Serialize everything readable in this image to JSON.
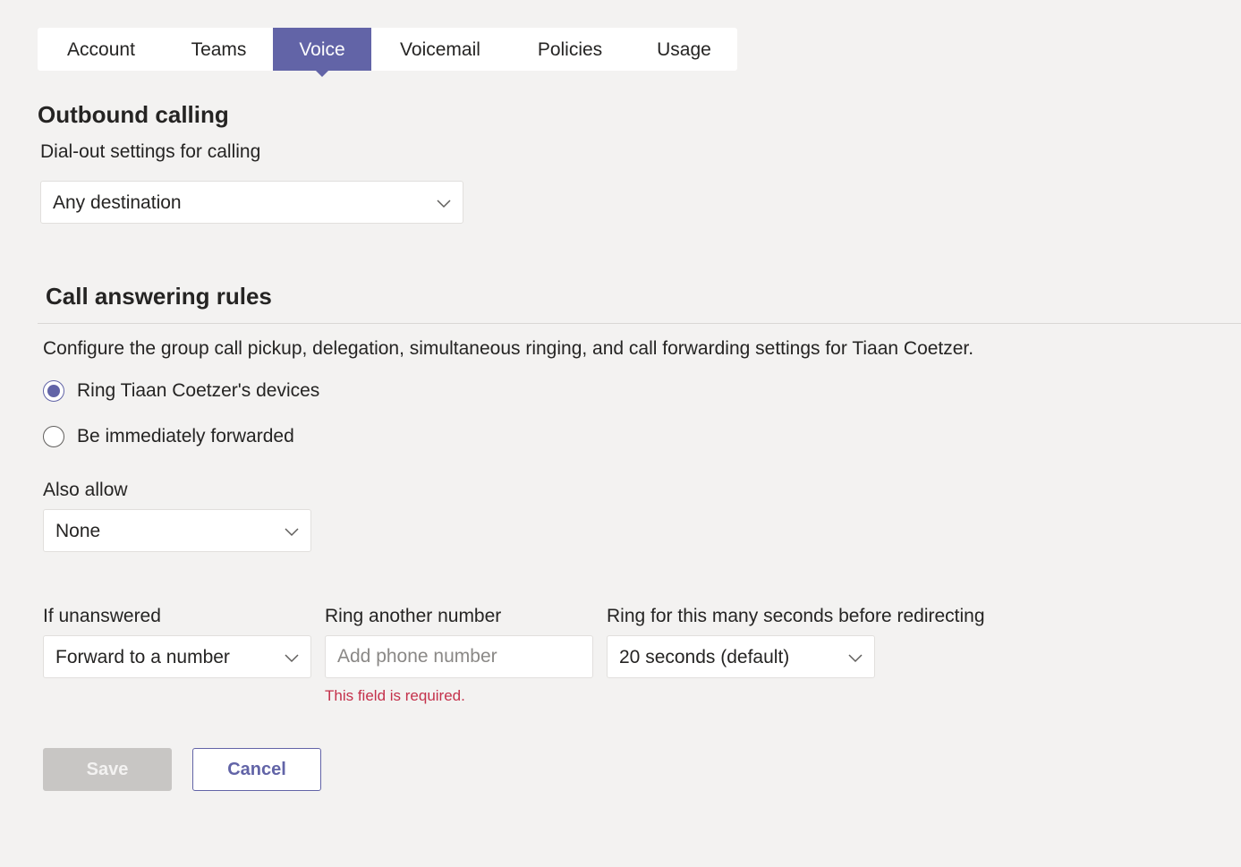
{
  "tabs": [
    {
      "label": "Account",
      "active": false
    },
    {
      "label": "Teams",
      "active": false
    },
    {
      "label": "Voice",
      "active": true
    },
    {
      "label": "Voicemail",
      "active": false
    },
    {
      "label": "Policies",
      "active": false
    },
    {
      "label": "Usage",
      "active": false
    }
  ],
  "outbound": {
    "heading": "Outbound calling",
    "dialout_label": "Dial-out settings for calling",
    "dialout_value": "Any destination"
  },
  "answering": {
    "heading": "Call answering rules",
    "description": "Configure the group call pickup, delegation, simultaneous ringing, and call forwarding settings for Tiaan Coetzer.",
    "radio_options": [
      {
        "label": "Ring Tiaan Coetzer's devices",
        "checked": true
      },
      {
        "label": "Be immediately forwarded",
        "checked": false
      }
    ],
    "also_allow_label": "Also allow",
    "also_allow_value": "None",
    "if_unanswered_label": "If unanswered",
    "if_unanswered_value": "Forward to a number",
    "ring_another_label": "Ring another number",
    "ring_another_placeholder": "Add phone number",
    "ring_another_value": "",
    "ring_seconds_label": "Ring for this many seconds before redirecting",
    "ring_seconds_value": "20 seconds (default)",
    "error_text": "This field is required."
  },
  "actions": {
    "save_label": "Save",
    "cancel_label": "Cancel"
  },
  "colors": {
    "accent": "#6264a7",
    "background": "#f3f2f1",
    "error": "#c4314b",
    "disabled": "#c8c6c4"
  },
  "icons": {
    "dropdown": "chevron-down-icon"
  }
}
